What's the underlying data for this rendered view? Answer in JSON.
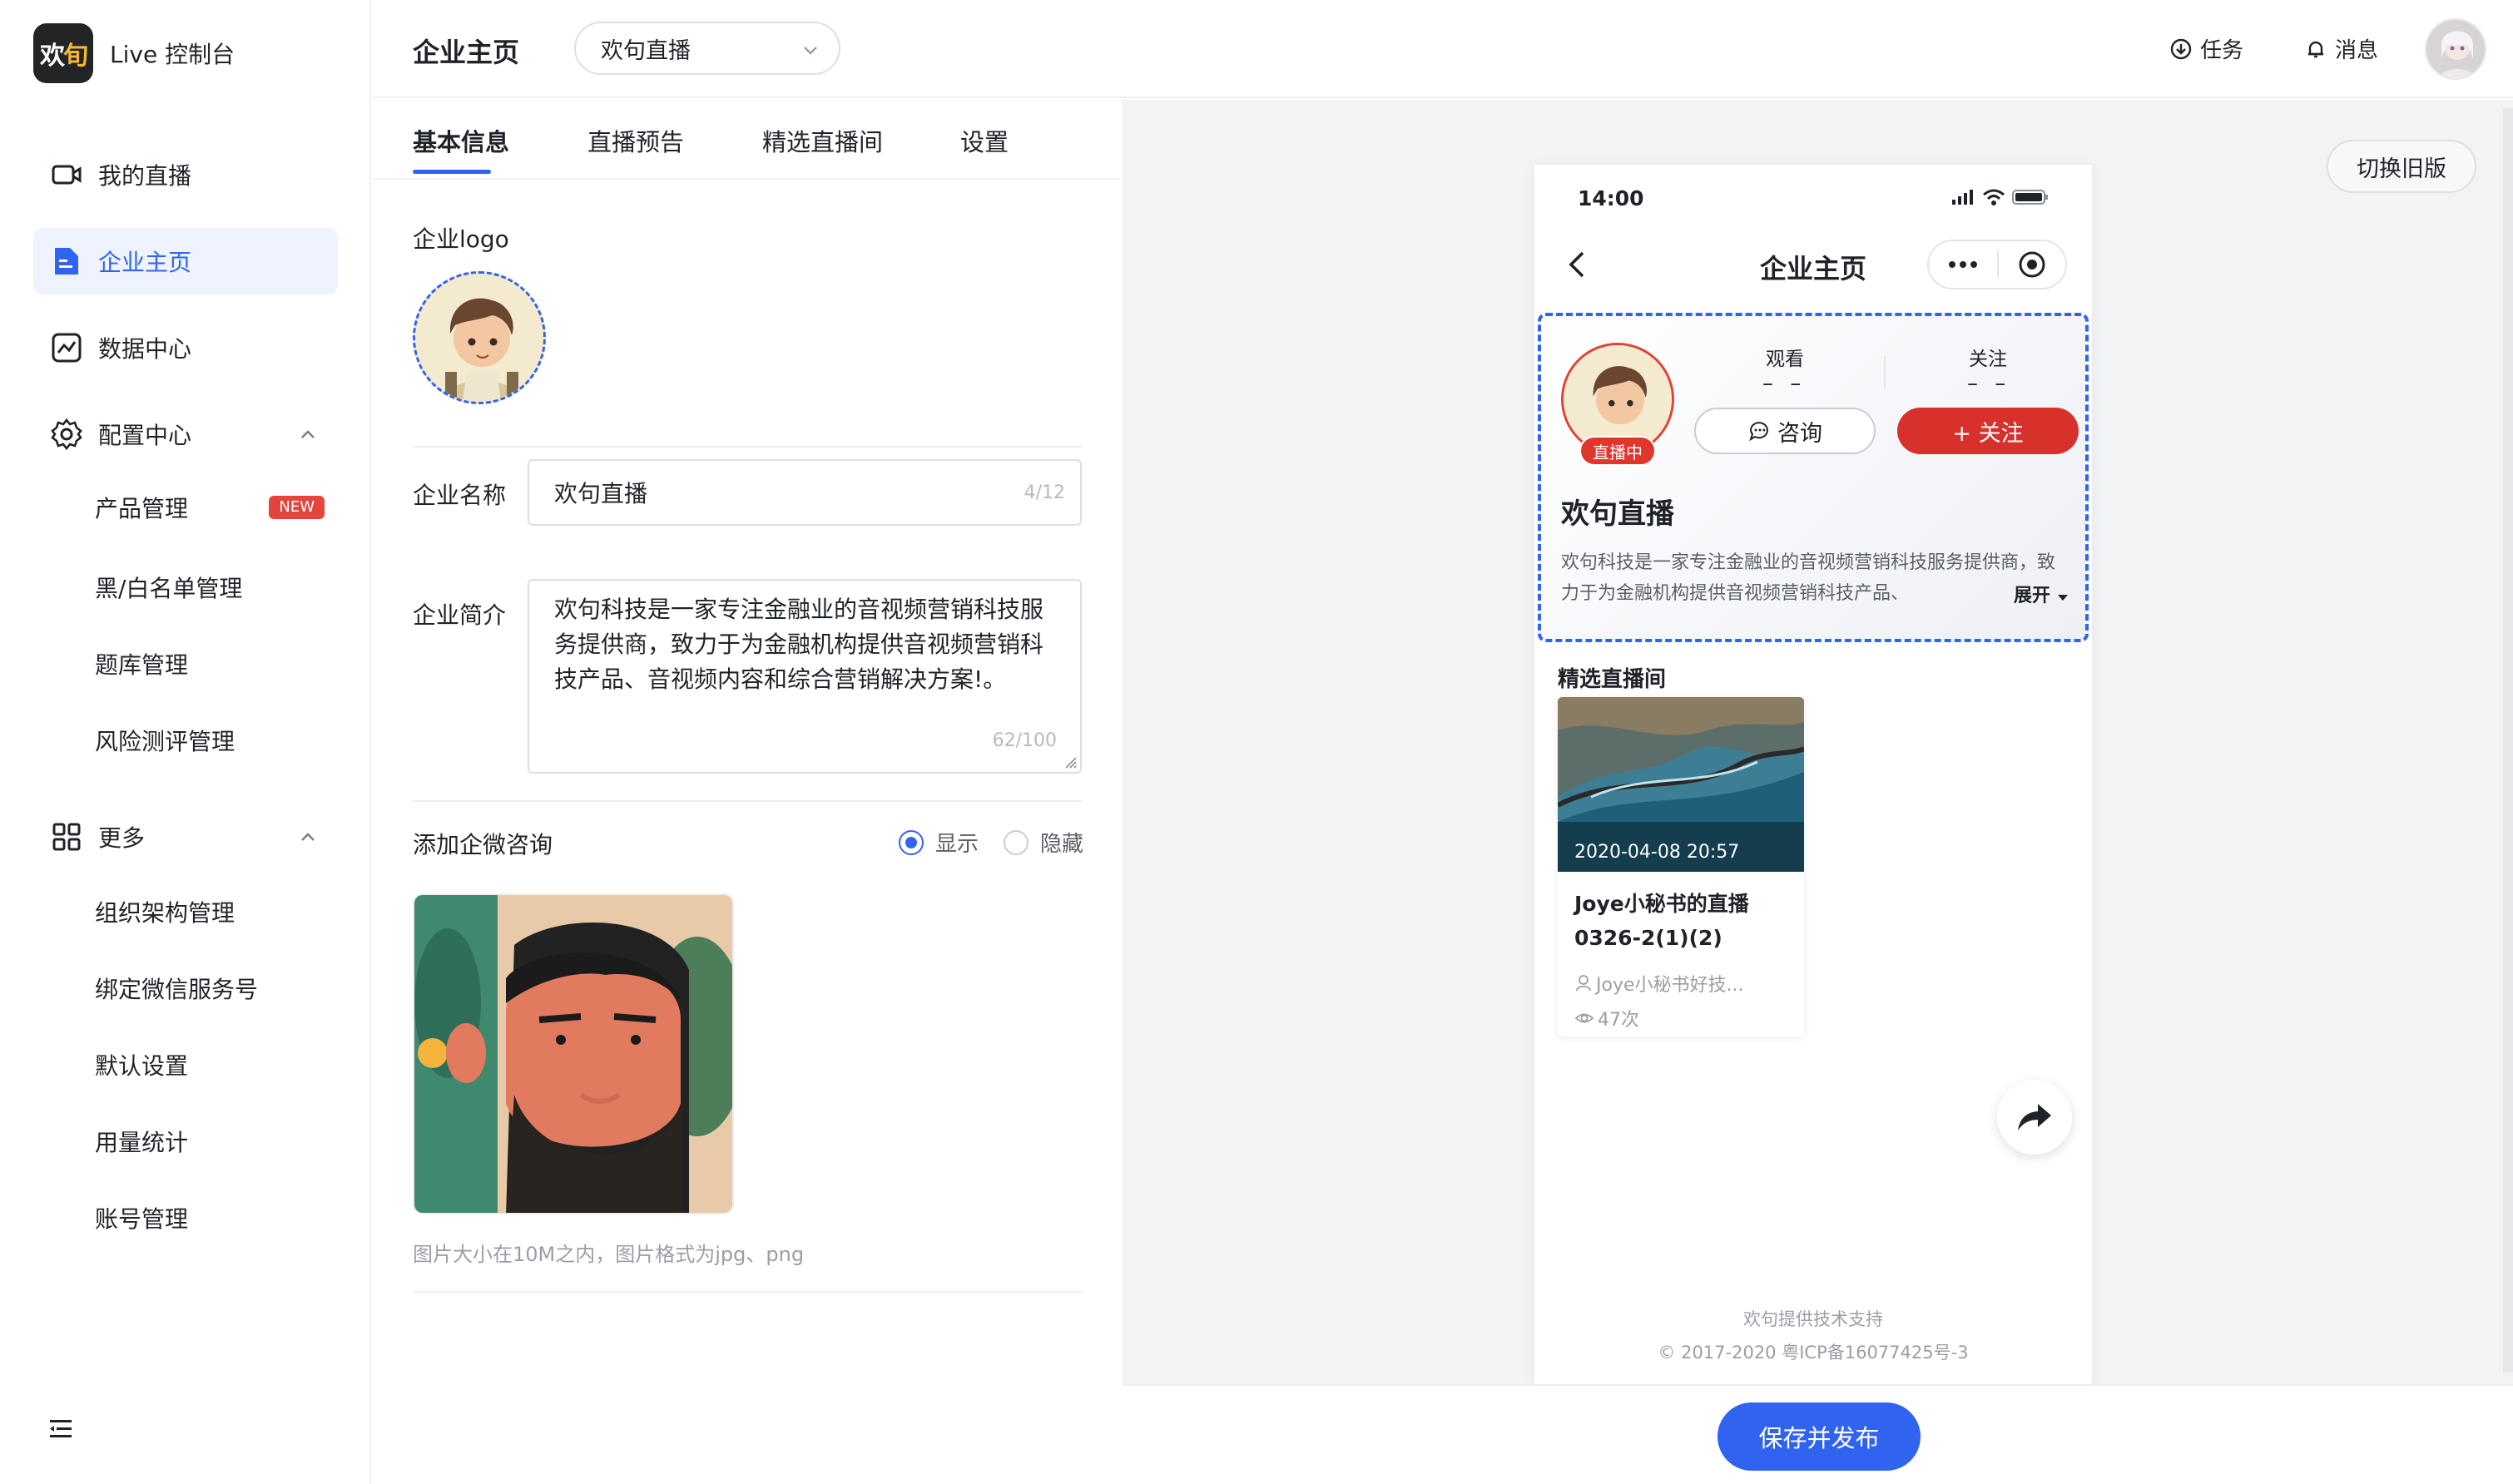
{
  "brand": {
    "logo_text": "欢",
    "logo_text_accent": "旬",
    "title": "Live 控制台"
  },
  "sidebar": {
    "items": [
      {
        "label": "我的直播",
        "icon": "video-icon"
      },
      {
        "label": "企业主页",
        "icon": "doc-icon",
        "active": true
      },
      {
        "label": "数据中心",
        "icon": "chart-icon"
      },
      {
        "label": "配置中心",
        "icon": "gear-icon",
        "expanded": true
      }
    ],
    "config_sub": [
      "产品管理",
      "黑/白名单管理",
      "题库管理",
      "风险测评管理"
    ],
    "new_badge": "NEW",
    "more_label": "更多",
    "more_sub": [
      "组织架构管理",
      "绑定微信服务号",
      "默认设置",
      "用量统计",
      "账号管理"
    ]
  },
  "header": {
    "title": "企业主页",
    "company_select": "欢句直播",
    "task": "任务",
    "message": "消息"
  },
  "tabs": [
    "基本信息",
    "直播预告",
    "精选直播间",
    "设置"
  ],
  "form": {
    "logo_label": "企业logo",
    "name_label": "企业名称",
    "name_value": "欢句直播",
    "name_counter": "4/12",
    "intro_label": "企业简介",
    "intro_value": "欢句科技是一家专注金融业的音视频营销科技服务提供商，致力于为金融机构提供音视频营销科技产品、音视频内容和综合营销解决方案!。",
    "intro_counter": "62/100",
    "wecom_label": "添加企微咨询",
    "radio_show": "显示",
    "radio_hide": "隐藏",
    "hint": "图片大小在10M之内，图片格式为jpg、png"
  },
  "preview": {
    "switch_old": "切换旧版",
    "time": "14:00",
    "nav_title": "企业主页",
    "live_tag": "直播中",
    "watch_label": "观看",
    "watch_value": "– –",
    "follow_label": "关注",
    "follow_value": "– –",
    "consult_btn": "咨询",
    "follow_btn": "+ 关注",
    "name": "欢句直播",
    "intro": "欢句科技是一家专注金融业的音视频营销科技服务提供商，致力于为金融机构提供音视频营销科技产品、",
    "expand": "展开",
    "featured_title": "精选直播间",
    "card": {
      "date": "2020-04-08 20:57",
      "title": "Joye小秘书的直播0326-2(1)(2)",
      "author": "Joye小秘书好技...",
      "views": "47次"
    },
    "footer_1": "欢句提供技术支持",
    "footer_2": "© 2017-2020 粤ICP备16077425号-3"
  },
  "bottom": {
    "save_btn": "保存并发布"
  },
  "colors": {
    "primary": "#2f63f0",
    "live_red": "#d8302b",
    "new_badge": "#e5443c"
  }
}
